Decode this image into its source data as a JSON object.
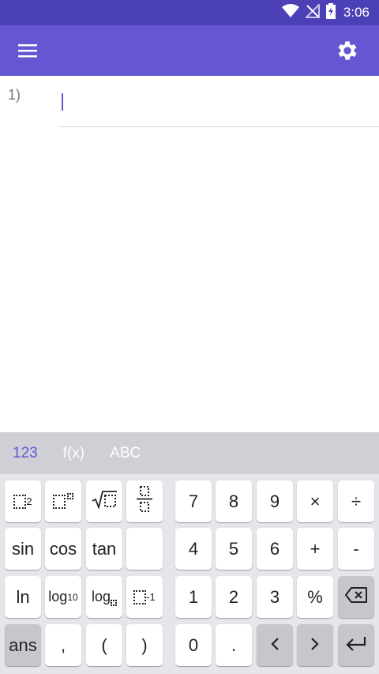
{
  "status_bar": {
    "time": "3:06"
  },
  "app_bar": {
    "menu_icon": "hamburger-menu-icon",
    "settings_icon": "gear-icon",
    "color": "#6557d2"
  },
  "worksheet": {
    "rows": [
      {
        "label": "1)",
        "value": ""
      }
    ]
  },
  "keyboard": {
    "tabs": [
      "123",
      "f(x)",
      "ABC"
    ],
    "active_tab": "123",
    "keys": {
      "sin": "sin",
      "cos": "cos",
      "tan": "tan",
      "ln": "ln",
      "log10": "log",
      "log10_sub": "10",
      "logb": "log",
      "ans": "ans",
      "comma": ",",
      "lparen": "(",
      "rparen": ")",
      "n7": "7",
      "n8": "8",
      "n9": "9",
      "times": "×",
      "divide": "÷",
      "n4": "4",
      "n5": "5",
      "n6": "6",
      "plus": "+",
      "minus": "-",
      "n1": "1",
      "n2": "2",
      "n3": "3",
      "percent": "%",
      "n0": "0",
      "dot": ".",
      "left": "<",
      "right": ">",
      "square_exp": "2",
      "inverse_exp": "-1"
    }
  }
}
